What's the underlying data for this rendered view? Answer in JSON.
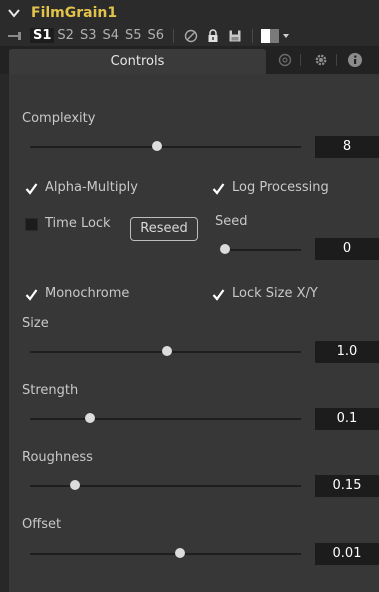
{
  "header": {
    "title": "FilmGrain1",
    "slots": [
      "S1",
      "S2",
      "S3",
      "S4",
      "S5",
      "S6"
    ],
    "active_slot": "S1"
  },
  "tabs": {
    "controls": "Controls"
  },
  "colors": {
    "title": "#e2c34a",
    "panel": "#373737",
    "background": "#282828",
    "value_box": "#1c1c1c"
  },
  "controls": {
    "complexity": {
      "label": "Complexity",
      "value": "8",
      "level": 0.47
    },
    "alpha_multiply": {
      "label": "Alpha-Multiply",
      "checked": true
    },
    "log_processing": {
      "label": "Log Processing",
      "checked": true
    },
    "time_lock": {
      "label": "Time Lock",
      "checked": false
    },
    "reseed": {
      "label": "Reseed"
    },
    "seed": {
      "label": "Seed",
      "value": "0",
      "level": 0.0
    },
    "monochrome": {
      "label": "Monochrome",
      "checked": true
    },
    "lock_size": {
      "label": "Lock Size X/Y",
      "checked": true
    },
    "size": {
      "label": "Size",
      "value": "1.0",
      "level": 0.5
    },
    "strength": {
      "label": "Strength",
      "value": "0.1",
      "level": 0.22
    },
    "roughness": {
      "label": "Roughness",
      "value": "0.15",
      "level": 0.17
    },
    "offset": {
      "label": "Offset",
      "value": "0.01",
      "level": 0.55
    }
  }
}
